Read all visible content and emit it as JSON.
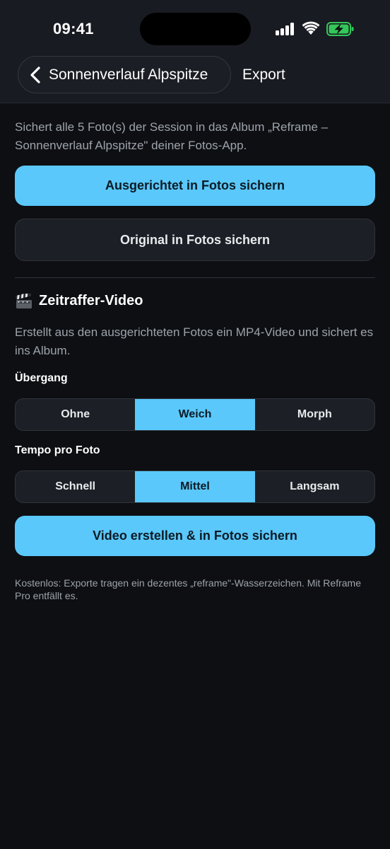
{
  "status_bar": {
    "time": "09:41"
  },
  "nav": {
    "title": "Sonnenverlauf Alpspitze",
    "export_label": "Export"
  },
  "intro_text": "Sichert alle 5 Foto(s) der Session in das Album „Reframe – Sonnenverlauf Alpspitze\" deiner Fotos-App.",
  "buttons": {
    "aligned_save": "Ausgerichtet in Fotos sichern",
    "original_save": "Original in Fotos sichern",
    "video_create": "Video erstellen & in Fotos sichern"
  },
  "timelapse": {
    "icon": "clapperboard-icon",
    "title": "Zeitraffer-Video",
    "description": "Erstellt aus den ausgerichteten Fotos ein MP4-Video und sichert es ins Album."
  },
  "transition": {
    "label": "Übergang",
    "options": [
      "Ohne",
      "Weich",
      "Morph"
    ],
    "selected": "Weich"
  },
  "tempo": {
    "label": "Tempo pro Foto",
    "options": [
      "Schnell",
      "Mittel",
      "Langsam"
    ],
    "selected": "Mittel"
  },
  "footnote": "Kostenlos: Exporte tragen ein dezentes „reframe\"-Wasserzeichen. Mit Reframe Pro entfällt es.",
  "colors": {
    "accent": "#5ac8fa",
    "background": "#0d0f13",
    "header": "#181b21",
    "battery_green": "#34c759"
  }
}
